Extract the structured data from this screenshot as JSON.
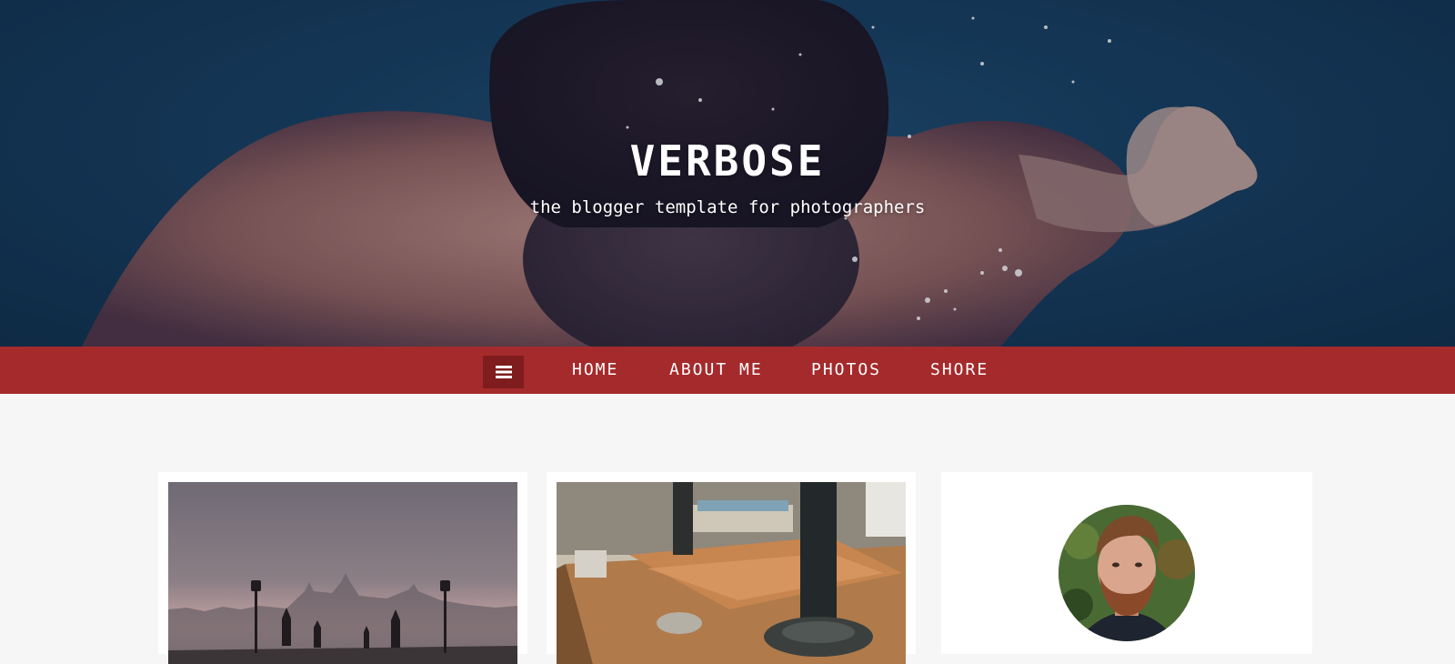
{
  "header": {
    "title": "VERBOSE",
    "description": "the blogger template for photographers",
    "hero_image": "underwater-swimmer-photo"
  },
  "nav": {
    "menu_icon": "hamburger-menu-icon",
    "items": [
      {
        "label": "HOME"
      },
      {
        "label": "ABOUT ME"
      },
      {
        "label": "PHOTOS"
      },
      {
        "label": "SHORE"
      }
    ]
  },
  "posts": [
    {
      "image": "foggy-bridge-statues-photo"
    },
    {
      "image": "leather-wallet-desk-photo"
    }
  ],
  "profile": {
    "avatar": "bearded-man-portrait-photo"
  },
  "colors": {
    "navbar": "#a52a2c",
    "menu_toggle": "#7e1c1e",
    "page_background": "#f6f6f6",
    "card_background": "#ffffff"
  }
}
